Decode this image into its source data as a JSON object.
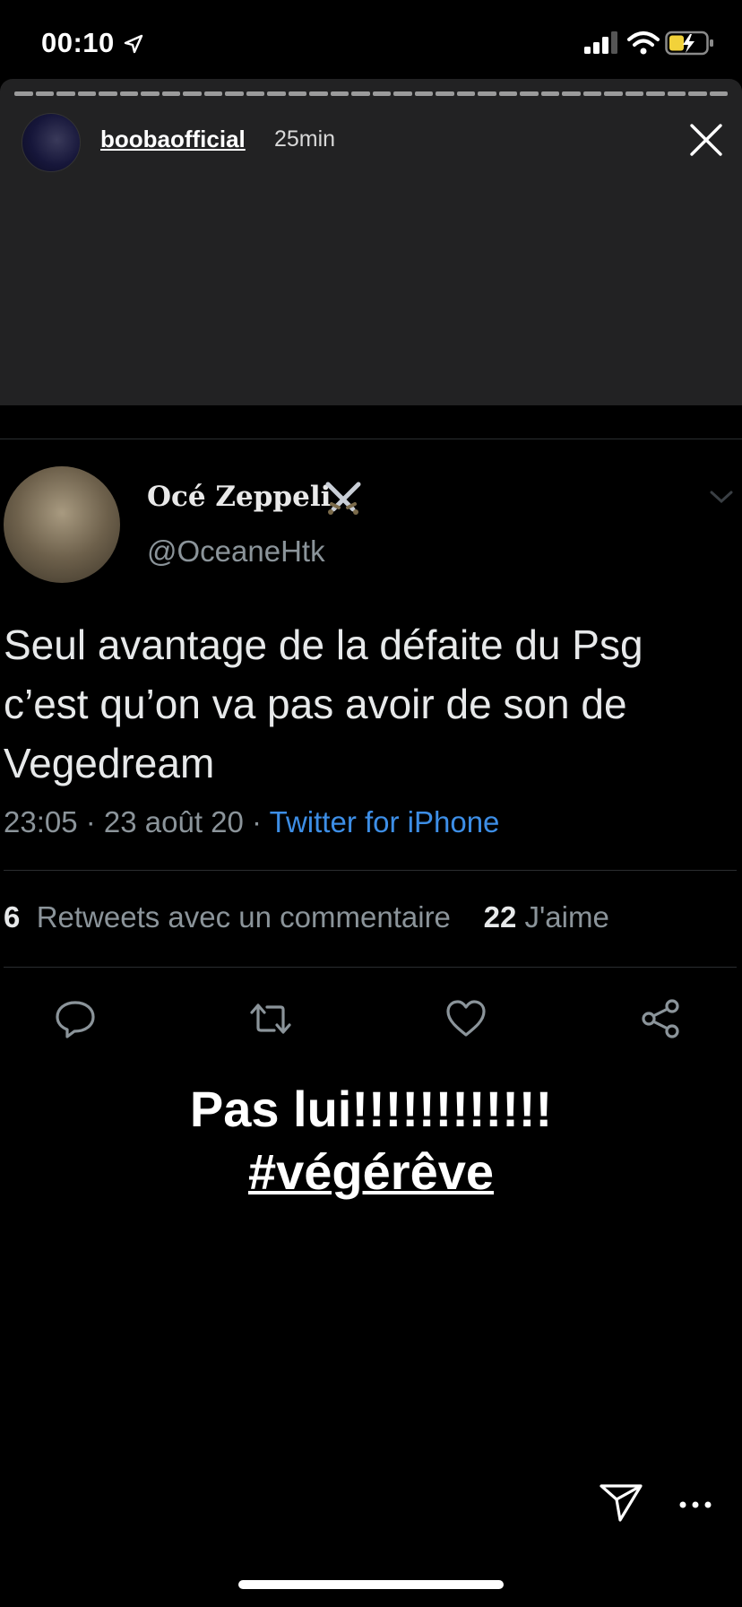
{
  "status_bar": {
    "time": "00:10"
  },
  "story": {
    "username": "boobaofficial",
    "time_ago": "25min",
    "progress_segments": 34,
    "caption_line1": "Pas lui!!!!!!!!!!!!",
    "caption_line2": "#végérêve"
  },
  "tweet": {
    "display_name": "Océ Zeppeli",
    "handle": "@OceaneHtk",
    "text": "Seul avantage de la défaite du Psg c’est qu’on va pas avoir de son de Vegedream",
    "meta_datetime": "23:05 · 23 août 20 · ",
    "meta_source": "Twitter for iPhone",
    "retweets_count": "6",
    "retweets_label": "Retweets avec un commentaire",
    "likes_count": "22",
    "likes_label": "J'aime"
  },
  "colors": {
    "background": "#000000",
    "story_card": "#222223",
    "link_blue": "#3d8ee6",
    "muted_text": "#8b949a"
  }
}
